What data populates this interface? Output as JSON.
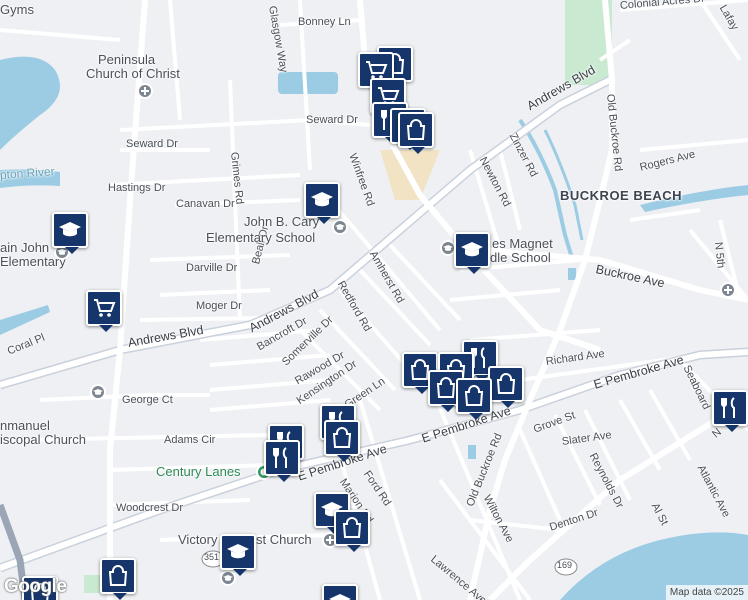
{
  "map": {
    "streets": [
      {
        "name": "Bonney Ln"
      },
      {
        "name": "Glasgow Way"
      },
      {
        "name": "Colonial Acres Dr"
      },
      {
        "name": "Lafay"
      },
      {
        "name": "Andrews Blvd"
      },
      {
        "name": "Seward Dr"
      },
      {
        "name": "Seward Dr"
      },
      {
        "name": "Grimes Rd"
      },
      {
        "name": "Winfree Rd"
      },
      {
        "name": "Zinzer Rd"
      },
      {
        "name": "Old Buckroe Rd"
      },
      {
        "name": "Rogers Ave"
      },
      {
        "name": "Newton Rd"
      },
      {
        "name": "Hastings Dr"
      },
      {
        "name": "Canavan Dr"
      },
      {
        "name": "Darville Dr"
      },
      {
        "name": "Beall Dr"
      },
      {
        "name": "Amherst Rd"
      },
      {
        "name": "Buckroe Ave"
      },
      {
        "name": "Moger Dr"
      },
      {
        "name": "Andrews Blvd"
      },
      {
        "name": "Andrews Blvd"
      },
      {
        "name": "Redford Rd"
      },
      {
        "name": "Bancroft Dr"
      },
      {
        "name": "Somerville Dr"
      },
      {
        "name": "Coral Pl"
      },
      {
        "name": "Rawood Dr"
      },
      {
        "name": "Kensington Dr"
      },
      {
        "name": "Richard Ave"
      },
      {
        "name": "E Pembroke Ave"
      },
      {
        "name": "Seaboard"
      },
      {
        "name": "George Ct"
      },
      {
        "name": "Green Ln"
      },
      {
        "name": "Grove St"
      },
      {
        "name": "E Pembroke Ave"
      },
      {
        "name": "Old Buckroe Rd"
      },
      {
        "name": "Slater Ave"
      },
      {
        "name": "Adams Cir"
      },
      {
        "name": "N"
      },
      {
        "name": "E Pembroke Ave"
      },
      {
        "name": "Reynolds Dr"
      },
      {
        "name": "Atlantic Ave"
      },
      {
        "name": "Marion Rd"
      },
      {
        "name": "Ford Rd"
      },
      {
        "name": "Wilton Ave"
      },
      {
        "name": "Al St"
      },
      {
        "name": "Denton Dr"
      },
      {
        "name": "Woodcrest Dr"
      },
      {
        "name": "Lawrence Ave"
      },
      {
        "name": "N 5th"
      }
    ],
    "places": {
      "church1": "Peninsula",
      "church2": "Church of Christ",
      "school1": "John B. Cary",
      "school2": "Elementary School",
      "school3": "es Magnet",
      "school4": "dle School",
      "school5": "ain John",
      "school6": "Elementary",
      "church3": "nmanuel",
      "church4": "iscopal Church",
      "church5": "Victory",
      "church6": "st Church",
      "gyms": "Gyms",
      "bowling": "Century Lanes",
      "neighborhood": "BUCKROE BEACH",
      "river": "pton River"
    },
    "route_shields": [
      "351",
      "169"
    ],
    "pin_icons": [
      "shopping-cart-icon",
      "restaurant-icon",
      "shopping-bag-icon",
      "school-icon"
    ],
    "attribution": "Map data ©2025",
    "logo": "Google"
  }
}
